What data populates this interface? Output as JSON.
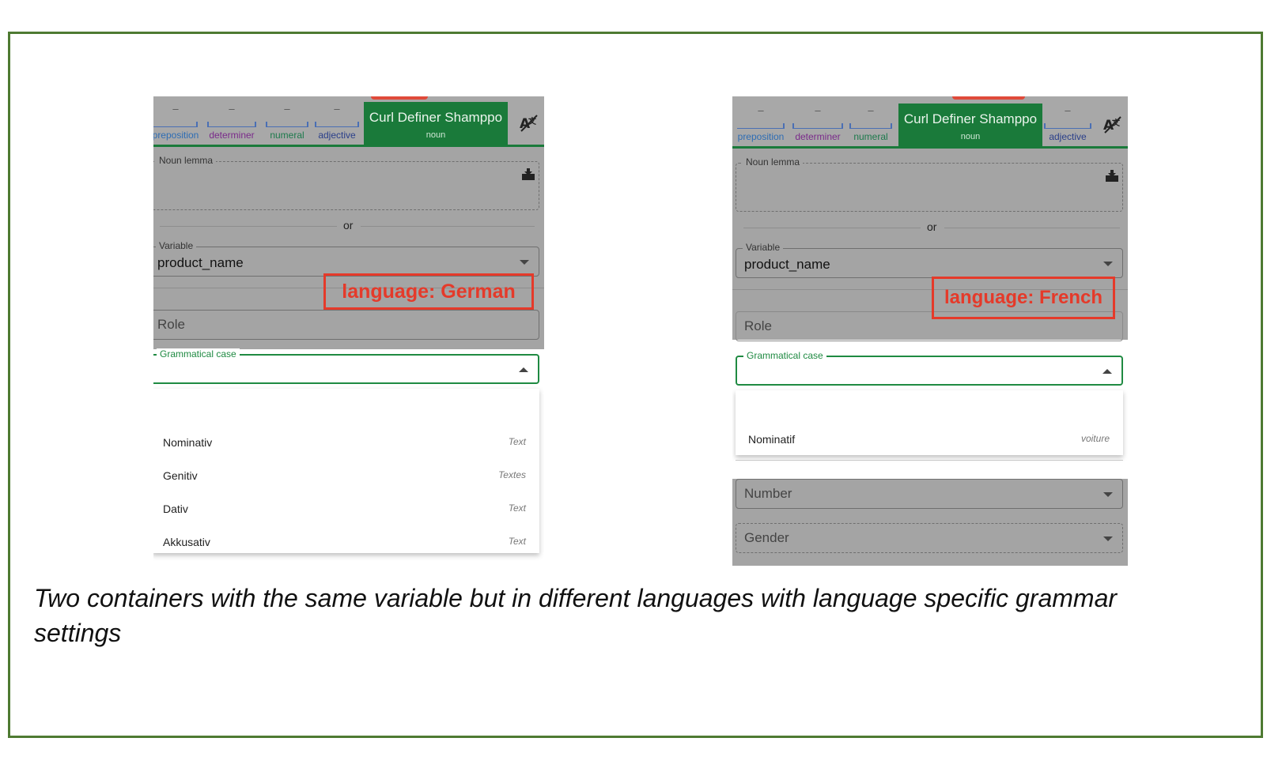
{
  "caption": "Two containers with the same variable but in different languages with language specific grammar settings",
  "colors": {
    "frame_border": "#4e7a32",
    "active_token": "#1a7a3a",
    "annotation": "#e53a2a",
    "focus_green": "#1f8a42"
  },
  "german": {
    "tokens": {
      "preposition": "preposition",
      "determiner": "determiner",
      "numeral": "numeral",
      "adjective": "adjective",
      "dash": "–"
    },
    "active_token": {
      "name": "Curl Definer Shamppo",
      "pos": "noun"
    },
    "translate_icon": "translate-off-icon",
    "noun_lemma_label": "Noun lemma",
    "lemma_icon": "download-box-icon",
    "or_text": "or",
    "variable_label": "Variable",
    "variable_value": "product_name",
    "annotation": "language: German",
    "role_placeholder": "Role",
    "grammatical_case_label": "Grammatical case",
    "case_options": [
      {
        "label": "Nominativ",
        "hint": "Text"
      },
      {
        "label": "Genitiv",
        "hint": "Textes"
      },
      {
        "label": "Dativ",
        "hint": "Text"
      },
      {
        "label": "Akkusativ",
        "hint": "Text"
      }
    ]
  },
  "french": {
    "tokens": {
      "preposition": "preposition",
      "determiner": "determiner",
      "numeral": "numeral",
      "adjective": "adjective",
      "dash": "–"
    },
    "active_token": {
      "name": "Curl Definer Shamppo",
      "pos": "noun"
    },
    "translate_icon": "translate-off-icon",
    "noun_lemma_label": "Noun lemma",
    "lemma_icon": "download-box-icon",
    "or_text": "or",
    "variable_label": "Variable",
    "variable_value": "product_name",
    "annotation": "language: French",
    "role_placeholder": "Role",
    "grammatical_case_label": "Grammatical case",
    "case_options": [
      {
        "label": "Nominatif",
        "hint": "voiture"
      }
    ],
    "number_placeholder": "Number",
    "gender_placeholder": "Gender"
  }
}
